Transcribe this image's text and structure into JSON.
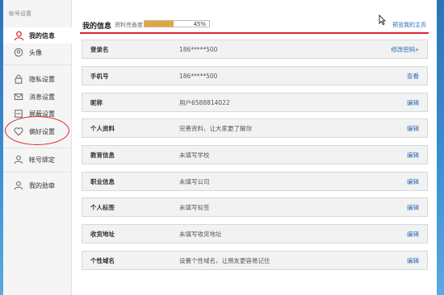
{
  "sidebar": {
    "title": "帐号设置",
    "items": [
      {
        "label": "我的信息",
        "icon": "person-red-icon"
      },
      {
        "label": "头像",
        "icon": "avatar-icon"
      },
      {
        "label": "隐私设置",
        "icon": "lock-icon"
      },
      {
        "label": "消息设置",
        "icon": "message-icon"
      },
      {
        "label": "屏蔽设置",
        "icon": "block-icon"
      },
      {
        "label": "偏好设置",
        "icon": "heart-icon"
      },
      {
        "label": "帐号绑定",
        "icon": "user-icon"
      },
      {
        "label": "我的勋章",
        "icon": "user-icon"
      }
    ]
  },
  "header": {
    "title": "我的信息",
    "progress_label": "资料完善度",
    "progress_text": "45%",
    "progress_fraction": 0.45,
    "preview_link": "预览我的主页"
  },
  "rows": [
    {
      "key": "登录名",
      "value": "186*****500",
      "action": "修改密码»"
    },
    {
      "key": "手机号",
      "value": "186*****500",
      "action": "查看"
    },
    {
      "key": "昵称",
      "value": "用户6588814022",
      "action": "编辑"
    },
    {
      "key": "个人资料",
      "value": "完善资料，让大家更了解你",
      "action": "编辑"
    },
    {
      "key": "教育信息",
      "value": "未填写学校",
      "action": "编辑"
    },
    {
      "key": "职业信息",
      "value": "未填写公司",
      "action": "编辑"
    },
    {
      "key": "个人标签",
      "value": "未填写标签",
      "action": "编辑"
    },
    {
      "key": "收货地址",
      "value": "未填写收货地址",
      "action": "编辑"
    },
    {
      "key": "个性域名",
      "value": "设置个性域名，让朋友更容易记住",
      "action": "编辑"
    }
  ],
  "colors": {
    "accent": "#d9242b",
    "link": "#2a6bb4",
    "progress": "#e1a73c"
  }
}
